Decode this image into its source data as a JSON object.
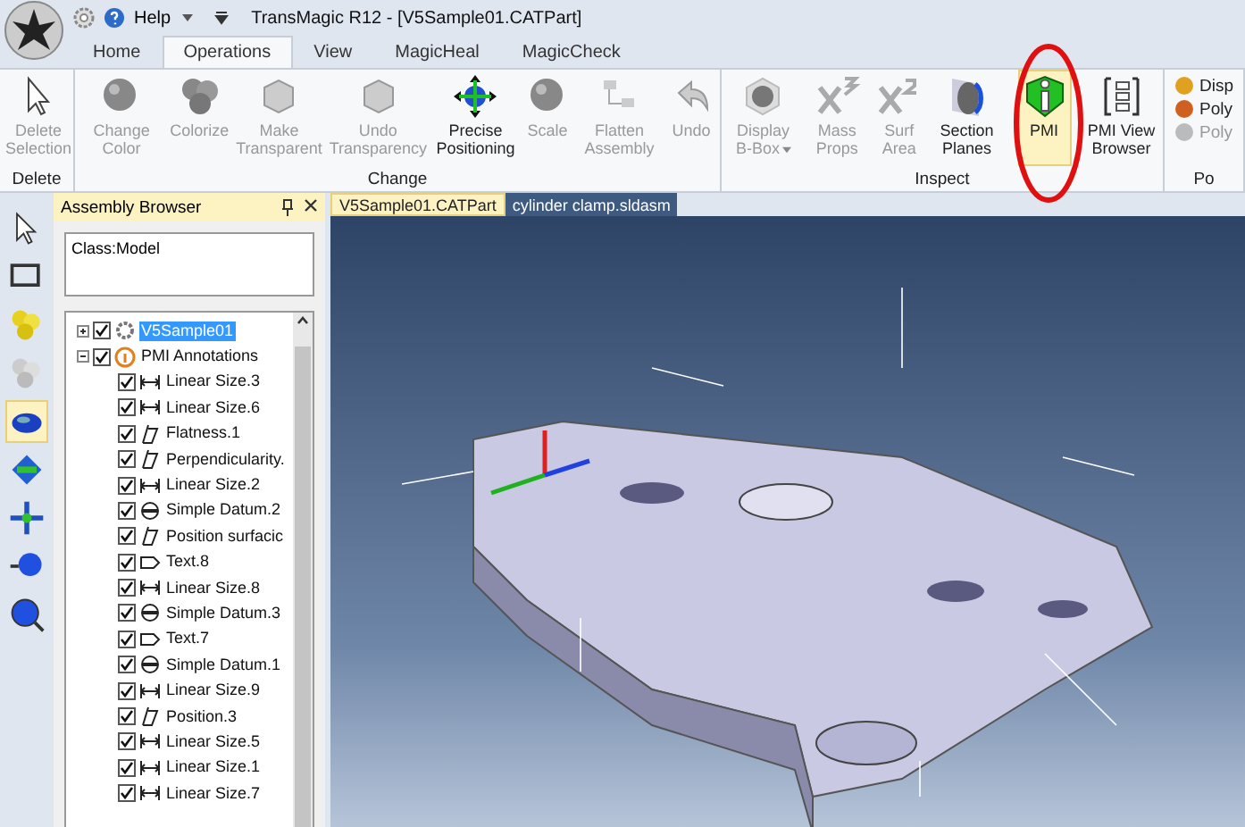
{
  "window": {
    "title": "TransMagic R12 - [V5Sample01.CATPart]",
    "help_menu": "Help"
  },
  "ribbon_tabs": [
    {
      "label": "Home",
      "selected": false
    },
    {
      "label": "Operations",
      "selected": true
    },
    {
      "label": "View",
      "selected": false
    },
    {
      "label": "MagicHeal",
      "selected": false
    },
    {
      "label": "MagicCheck",
      "selected": false
    }
  ],
  "ribbon_groups": [
    {
      "label": "Delete",
      "buttons": [
        {
          "label": "Delete Selection",
          "disabled": true,
          "selected": false
        }
      ]
    },
    {
      "label": "Change",
      "buttons": [
        {
          "label": "Change Color",
          "disabled": true,
          "selected": false
        },
        {
          "label": "Colorize",
          "disabled": true,
          "selected": false
        },
        {
          "label": "Make Transparent",
          "disabled": true,
          "selected": false
        },
        {
          "label": "Undo Transparency",
          "disabled": true,
          "selected": false
        },
        {
          "label": "Precise Positioning",
          "disabled": false,
          "selected": false
        },
        {
          "label": "Scale",
          "disabled": true,
          "selected": false
        },
        {
          "label": "Flatten Assembly",
          "disabled": true,
          "selected": false
        },
        {
          "label": "Undo",
          "disabled": true,
          "selected": false
        }
      ]
    },
    {
      "label": "Inspect",
      "buttons": [
        {
          "label": "Display B-Box",
          "disabled": true,
          "selected": false,
          "dropdown": true
        },
        {
          "label": "Mass Props",
          "disabled": true,
          "selected": false
        },
        {
          "label": "Surf Area",
          "disabled": true,
          "selected": false
        },
        {
          "label": "Section Planes",
          "disabled": false,
          "selected": false
        },
        {
          "label": "PMI",
          "disabled": false,
          "selected": true
        },
        {
          "label": "PMI View Browser",
          "disabled": false,
          "selected": false
        }
      ]
    },
    {
      "label": "Po",
      "small_buttons": [
        {
          "label": "Disp",
          "disabled": false
        },
        {
          "label": "Poly",
          "disabled": false
        },
        {
          "label": "Poly",
          "disabled": true
        }
      ]
    }
  ],
  "browser": {
    "title": "Assembly Browser",
    "filter": "Class:Model",
    "tree": [
      {
        "label": "V5Sample01",
        "checked": true,
        "selected": true,
        "expanded": false,
        "kind": "model"
      },
      {
        "label": "PMI Annotations",
        "checked": true,
        "selected": false,
        "expanded": true,
        "kind": "pmi",
        "children": [
          {
            "label": "Linear Size.3",
            "checked": true,
            "kind": "linear"
          },
          {
            "label": "Linear Size.6",
            "checked": true,
            "kind": "linear"
          },
          {
            "label": "Flatness.1",
            "checked": true,
            "kind": "form"
          },
          {
            "label": "Perpendicularity.",
            "checked": true,
            "kind": "form"
          },
          {
            "label": "Linear Size.2",
            "checked": true,
            "kind": "linear"
          },
          {
            "label": "Simple Datum.2",
            "checked": true,
            "kind": "datum"
          },
          {
            "label": "Position surfacic",
            "checked": true,
            "kind": "form"
          },
          {
            "label": "Text.8",
            "checked": true,
            "kind": "text"
          },
          {
            "label": "Linear Size.8",
            "checked": true,
            "kind": "linear"
          },
          {
            "label": "Simple Datum.3",
            "checked": true,
            "kind": "datum"
          },
          {
            "label": "Text.7",
            "checked": true,
            "kind": "text"
          },
          {
            "label": "Simple Datum.1",
            "checked": true,
            "kind": "datum"
          },
          {
            "label": "Linear Size.9",
            "checked": true,
            "kind": "linear"
          },
          {
            "label": "Position.3",
            "checked": true,
            "kind": "form"
          },
          {
            "label": "Linear Size.5",
            "checked": true,
            "kind": "linear"
          },
          {
            "label": "Linear Size.1",
            "checked": true,
            "kind": "linear"
          },
          {
            "label": "Linear Size.7",
            "checked": true,
            "kind": "linear"
          }
        ]
      }
    ]
  },
  "tools": [
    {
      "selected": false
    },
    {
      "selected": false
    },
    {
      "selected": false
    },
    {
      "selected": false
    },
    {
      "selected": true
    },
    {
      "selected": false
    },
    {
      "selected": false
    },
    {
      "selected": false
    },
    {
      "selected": false
    }
  ],
  "doc_tabs": [
    {
      "label": "V5Sample01.CATPart",
      "selected": true
    },
    {
      "label": "cylinder clamp.sldasm",
      "selected": false
    }
  ]
}
